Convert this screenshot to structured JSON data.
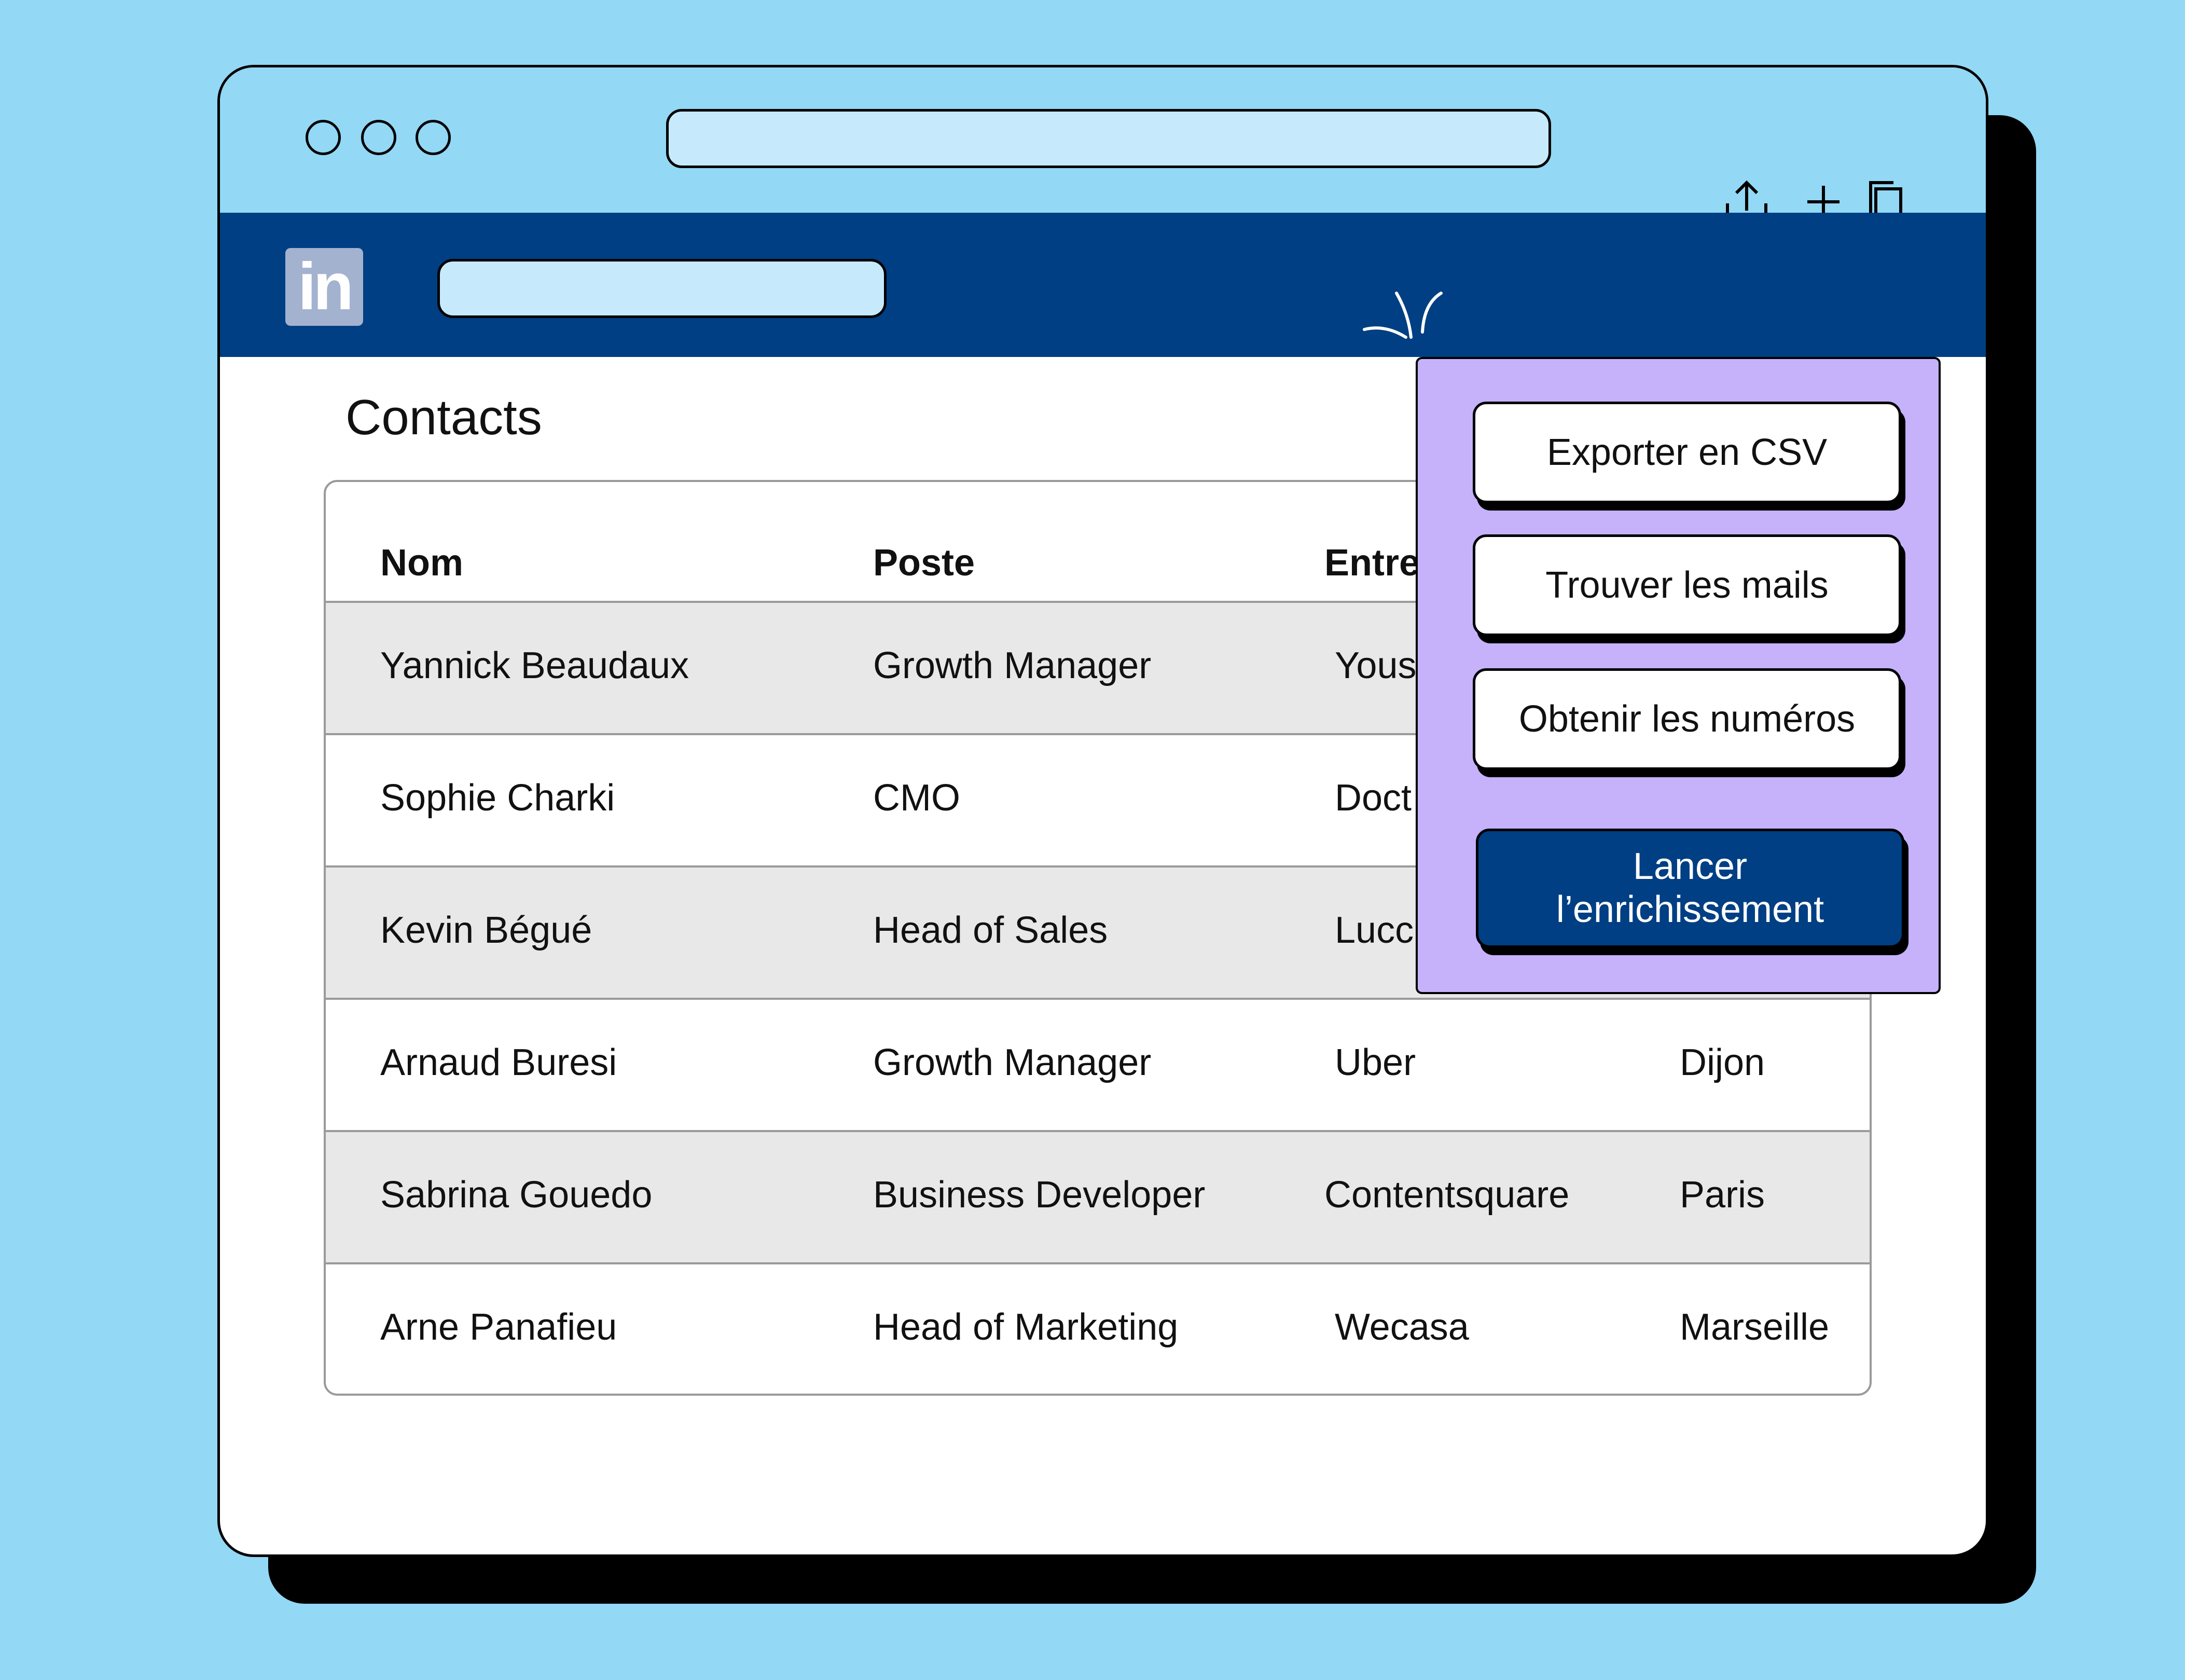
{
  "header": {
    "logo_text": "in"
  },
  "page": {
    "title": "Contacts"
  },
  "table": {
    "columns": [
      "Nom",
      "Poste",
      "Entre",
      ""
    ],
    "rows": [
      [
        "Yannick Beaudaux",
        "Growth Manager",
        "Yous",
        ""
      ],
      [
        "Sophie Charki",
        "CMO",
        "Doct",
        ""
      ],
      [
        "Kevin Bégué",
        "Head of Sales",
        "Lucc",
        ""
      ],
      [
        "Arnaud Buresi",
        "Growth Manager",
        "Uber",
        "Dijon"
      ],
      [
        "Sabrina Gouedo",
        "Business Developer",
        "Contentsquare",
        "Paris"
      ],
      [
        "Arne Panafieu",
        "Head of Marketing",
        "Wecasa",
        "Marseille"
      ]
    ]
  },
  "menu": {
    "export_csv": "Exporter en CSV",
    "find_emails": "Trouver les mails",
    "get_numbers": "Obtenir les numéros",
    "launch_line1": "Lancer",
    "launch_line2": "l’enrichissement"
  },
  "colors": {
    "background": "#93d8f5",
    "brand_navy": "#003f83",
    "menu_purple": "#c5b2fb",
    "row_alt": "#e8e8e8"
  },
  "icons": [
    "share-icon",
    "plus-icon",
    "copy-icon",
    "linkedin-logo"
  ]
}
